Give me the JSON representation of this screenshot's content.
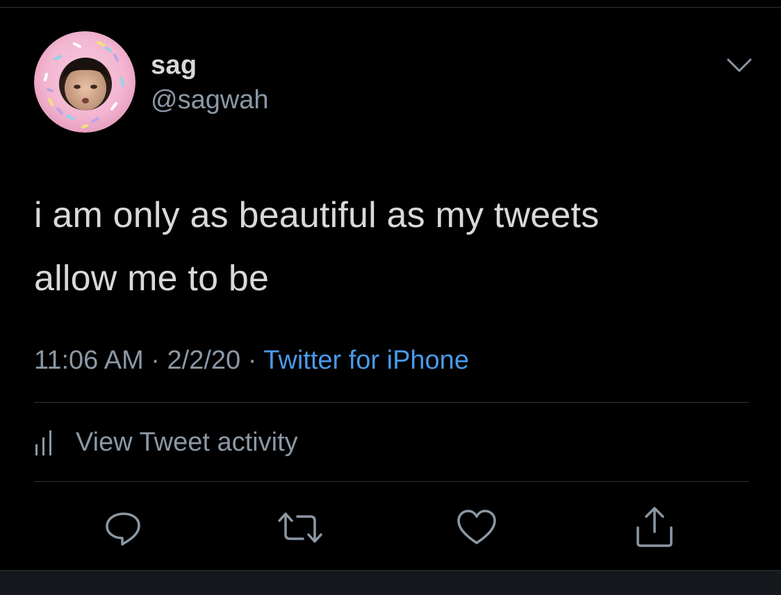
{
  "user": {
    "display_name": "sag",
    "handle": "@sagwah"
  },
  "tweet": {
    "text_line1": "i am only as beautiful as my tweets",
    "text_line2": "allow me to be",
    "time": "11:06 AM",
    "separator": "·",
    "date": "2/2/20",
    "source": "Twitter for iPhone"
  },
  "activity": {
    "label": "View Tweet activity"
  },
  "actions": {
    "icons": [
      "reply-icon",
      "retweet-icon",
      "like-icon",
      "share-icon"
    ]
  },
  "colors": {
    "background": "#000000",
    "primary_text": "#d9d9d9",
    "secondary_text": "#8b98a5",
    "link": "#4a99e9",
    "divider": "#2f3336"
  }
}
